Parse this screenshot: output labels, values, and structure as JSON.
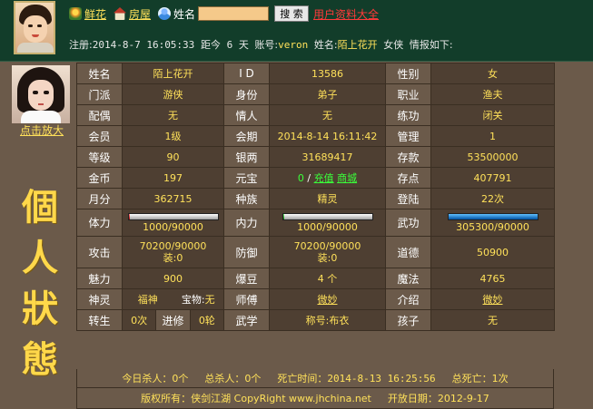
{
  "nav": {
    "flower_icon": "flower-icon",
    "flower_label": "鲜花",
    "house_icon": "house-icon",
    "house_label": "房屋",
    "name_icon": "user-icon",
    "name_label": "姓名",
    "search_value": "",
    "search_button": "搜 索",
    "user_all_link": "用户资料大全"
  },
  "info": {
    "reg_label": "注册:",
    "reg_date": "2014-8-7 16:05:33",
    "since_label": "距今",
    "since_days": "6",
    "days_unit": "天",
    "account_label": "账号:",
    "account": "veron",
    "name_label": "姓名:",
    "name": "陌上花开",
    "gender_title": "女侠",
    "tail": "情报如下:"
  },
  "left": {
    "enlarge_link": "点击放大",
    "big_title": [
      "個",
      "人",
      "狀",
      "態"
    ]
  },
  "table": {
    "r1": [
      "姓名",
      "陌上花开",
      "I D",
      "13586",
      "性别",
      "女"
    ],
    "r2": [
      "门派",
      "游侠",
      "身份",
      "弟子",
      "职业",
      "渔夫"
    ],
    "r3": [
      "配偶",
      "无",
      "情人",
      "无",
      "练功",
      "闭关"
    ],
    "r4": [
      "会员",
      "1级",
      "会期",
      "2014-8-14 16:11:42",
      "管理",
      "1"
    ],
    "r5": [
      "等级",
      "90",
      "银两",
      "31689417",
      "存款",
      "53500000"
    ],
    "r6_lb": "金币",
    "r6_gold": "197",
    "r6_yuanbao_lb": "元宝",
    "r6_yuanbao": "0",
    "r6_sep": "/",
    "r6_recharge": "充值",
    "r6_mall": "商城",
    "r6_point_lb": "存点",
    "r6_point": "407791",
    "r7": [
      "月分",
      "362715",
      "种族",
      "精灵",
      "登陆",
      "22次"
    ],
    "r8": {
      "hp_lb": "体力",
      "hp": "1000/90000",
      "hp_frac": 0.011,
      "mp_lb": "内力",
      "mp": "1000/90000",
      "mp_frac": 0.011,
      "wg_lb": "武功",
      "wg": "305300/90000",
      "wg_frac": 1.0
    },
    "r9": {
      "atk_lb": "攻击",
      "atk": "70200/90000",
      "atk_equip": "装:0",
      "def_lb": "防御",
      "def": "70200/90000",
      "def_equip": "装:0",
      "moral_lb": "道德",
      "moral": "50900"
    },
    "r10": [
      "魅力",
      "900",
      "爆豆",
      "4 个",
      "魔法",
      "4765"
    ],
    "r11": {
      "spirit_lb": "神灵",
      "spirit": "福神",
      "treasure_lb": "宝物:",
      "treasure": "无",
      "master_lb": "师傅",
      "master": "微妙",
      "intro_lb": "介绍",
      "intro": "微妙"
    },
    "r12": {
      "reborn_lb": "转生",
      "reborn": "0次",
      "advance_lb": "进修",
      "advance": "0轮",
      "school_lb": "武学",
      "title_lb": "称号:",
      "title": "布衣",
      "child_lb": "孩子",
      "child": "无"
    }
  },
  "footer": {
    "kill_today": "今日杀人：0个",
    "kill_total": "总杀人：0个",
    "death_time": "死亡时间：2014-8-13 16:25:56",
    "death_total": "总死亡：1次",
    "copyright": "版权所有：侠剑江湖 CopyRight www.jhchina.net",
    "open_date": "开放日期：2012-9-17"
  },
  "colors": {
    "topbar_bg": "#123d2a",
    "panel_bg": "#6b5a4a",
    "value_text": "#ffe15a",
    "link_red": "#ff3a3a",
    "link_green": "#3aff3a"
  }
}
